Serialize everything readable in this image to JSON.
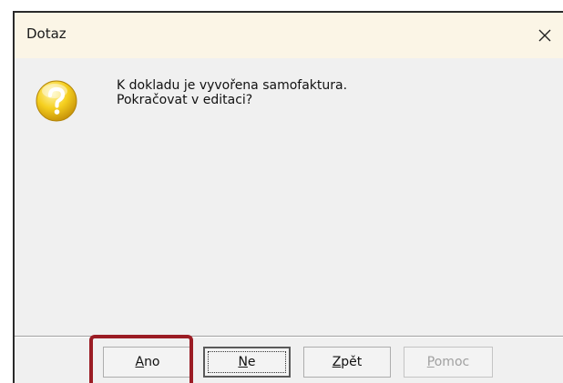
{
  "dialog": {
    "title": "Dotaz",
    "close_symbol": "close-icon",
    "icon": "question-icon",
    "message_lines": [
      "K dokladu je vyvořena samofaktura.",
      "Pokračovat v editaci?"
    ]
  },
  "buttons": {
    "ano": {
      "accel": "A",
      "rest": "no"
    },
    "ne": {
      "accel": "N",
      "rest": "e"
    },
    "zpet": {
      "accel": "Z",
      "rest": "pět"
    },
    "pomoc": {
      "accel": "P",
      "rest": "omoc",
      "disabled": true
    }
  },
  "colors": {
    "titlebar": "#fbf5e6",
    "dialog_bg": "#f0f0f0",
    "highlight": "#9b1c24",
    "icon_yellow": "#f2c21a"
  }
}
